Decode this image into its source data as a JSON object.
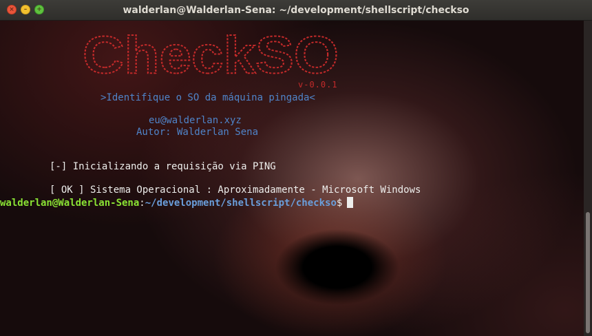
{
  "window": {
    "title": "walderlan@Walderlan-Sena: ~/development/shellscript/checkso"
  },
  "banner": {
    "art_text": "CheckSO",
    "version": "v-0.0.1",
    "tagline": ">Identifique o SO da máquina pingada<",
    "email": "eu@walderlan.xyz",
    "author": "Autor: Walderlan Sena"
  },
  "output": {
    "init_line": "[-] Inicializando a requisição via PING",
    "ok_line": "[ OK ] Sistema Operacional : Aproximadamente - Microsoft Windows"
  },
  "prompt": {
    "user_host": "walderlan@Walderlan-Sena",
    "separator": ":",
    "path": "~/development/shellscript/checkso",
    "symbol": "$"
  },
  "colors": {
    "banner_red": "#c32a2a",
    "info_blue": "#4f84c9",
    "prompt_green": "#8ae234",
    "prompt_blue": "#6a9edb",
    "text": "#eeeeec"
  }
}
